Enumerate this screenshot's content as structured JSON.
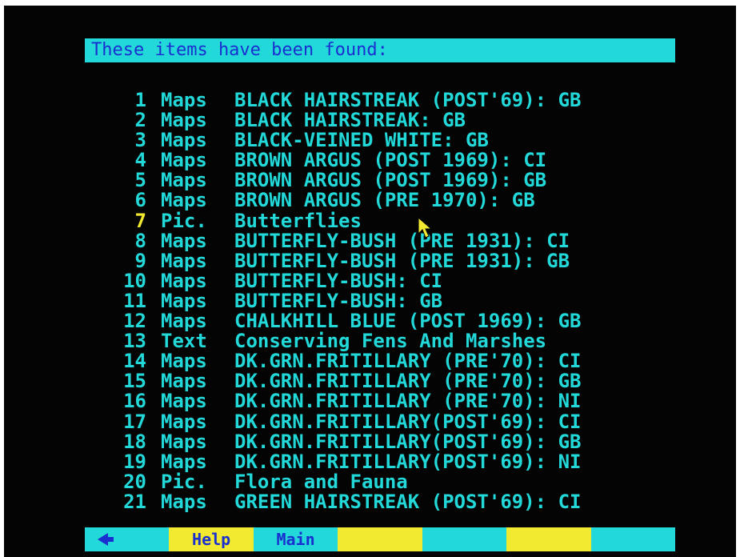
{
  "header": {
    "title": "These items have been found:"
  },
  "results": [
    {
      "num": "1",
      "type": "Maps",
      "title": "BLACK HAIRSTREAK (POST'69): GB"
    },
    {
      "num": "2",
      "type": "Maps",
      "title": "BLACK HAIRSTREAK: GB"
    },
    {
      "num": "3",
      "type": "Maps",
      "title": "BLACK-VEINED WHITE: GB"
    },
    {
      "num": "4",
      "type": "Maps",
      "title": "BROWN ARGUS (POST 1969): CI"
    },
    {
      "num": "5",
      "type": "Maps",
      "title": "BROWN ARGUS (POST 1969): GB"
    },
    {
      "num": "6",
      "type": "Maps",
      "title": "BROWN ARGUS (PRE 1970): GB"
    },
    {
      "num": "7",
      "type": "Pic.",
      "title": "Butterflies"
    },
    {
      "num": "8",
      "type": "Maps",
      "title": "BUTTERFLY-BUSH (PRE 1931): CI"
    },
    {
      "num": "9",
      "type": "Maps",
      "title": "BUTTERFLY-BUSH (PRE 1931): GB"
    },
    {
      "num": "10",
      "type": "Maps",
      "title": "BUTTERFLY-BUSH: CI"
    },
    {
      "num": "11",
      "type": "Maps",
      "title": "BUTTERFLY-BUSH: GB"
    },
    {
      "num": "12",
      "type": "Maps",
      "title": "CHALKHILL BLUE (POST 1969): GB"
    },
    {
      "num": "13",
      "type": "Text",
      "title": "Conserving Fens And Marshes"
    },
    {
      "num": "14",
      "type": "Maps",
      "title": "DK.GRN.FRITILLARY (PRE'70): CI"
    },
    {
      "num": "15",
      "type": "Maps",
      "title": "DK.GRN.FRITILLARY (PRE'70): GB"
    },
    {
      "num": "16",
      "type": "Maps",
      "title": "DK.GRN.FRITILLARY (PRE'70): NI"
    },
    {
      "num": "17",
      "type": "Maps",
      "title": "DK.GRN.FRITILLARY(POST'69): CI"
    },
    {
      "num": "18",
      "type": "Maps",
      "title": "DK.GRN.FRITILLARY(POST'69): GB"
    },
    {
      "num": "19",
      "type": "Maps",
      "title": "DK.GRN.FRITILLARY(POST'69): NI"
    },
    {
      "num": "20",
      "type": "Pic.",
      "title": "Flora and Fauna"
    },
    {
      "num": "21",
      "type": "Maps",
      "title": "GREEN HAIRSTREAK (POST'69): CI"
    }
  ],
  "selected_item": "7",
  "footer": {
    "back_icon": "left-arrow-icon",
    "keys": [
      {
        "id": "back",
        "label": "",
        "color": "cyan"
      },
      {
        "id": "help",
        "label": "Help",
        "color": "yellow"
      },
      {
        "id": "main",
        "label": "Main",
        "color": "cyan"
      },
      {
        "id": "f4",
        "label": "",
        "color": "yellow"
      },
      {
        "id": "f5",
        "label": "",
        "color": "cyan"
      },
      {
        "id": "f6",
        "label": "",
        "color": "yellow"
      },
      {
        "id": "f7",
        "label": "",
        "color": "cyan"
      }
    ]
  },
  "colors": {
    "background": "#040404",
    "cyan": "#22d8d8",
    "yellow": "#f2ea30",
    "blue_text": "#1a2fd0",
    "pointer": "#f2ea30"
  }
}
